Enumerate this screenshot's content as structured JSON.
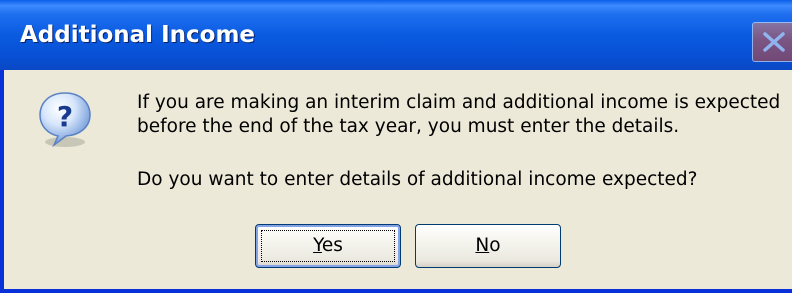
{
  "window": {
    "title": "Additional Income"
  },
  "message": {
    "line1": "If you are making an interim claim and additional income is expected",
    "line2": "before the end of the tax year, you must enter the details.",
    "question": "Do you want to enter details of additional income expected?"
  },
  "buttons": {
    "yes": {
      "accel": "Y",
      "rest": "es"
    },
    "no": {
      "accel": "N",
      "rest": "o"
    }
  },
  "icons": {
    "dialog": "question-icon",
    "close": "close-icon"
  },
  "colors": {
    "titlebar": "#0a5be0",
    "dialog_bg": "#ece9d8",
    "close_button": "#d8543a"
  }
}
